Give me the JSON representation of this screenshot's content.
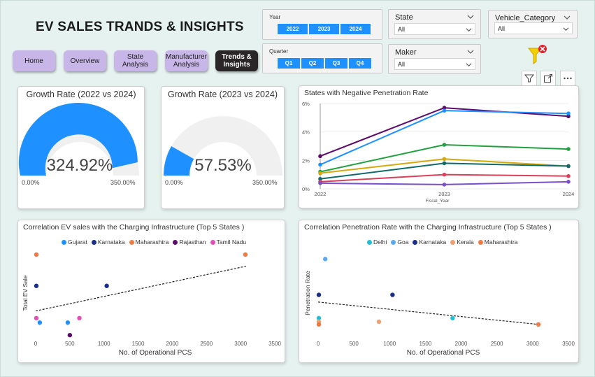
{
  "title": "EV SALES TRANDS & INSIGHTS",
  "nav": [
    {
      "label": "Home",
      "active": false
    },
    {
      "label": "Overview",
      "active": false
    },
    {
      "label": "State Analysis",
      "active": false
    },
    {
      "label": "Manufacturer Analysis",
      "active": false
    },
    {
      "label": "Trends & Insights",
      "active": true
    }
  ],
  "filters": {
    "year": {
      "label": "Year",
      "options": [
        "2022",
        "2023",
        "2024"
      ]
    },
    "quarter": {
      "label": "Quarter",
      "options": [
        "Q1",
        "Q2",
        "Q3",
        "Q4"
      ]
    },
    "state": {
      "label": "State",
      "value": "All"
    },
    "maker": {
      "label": "Maker",
      "value": "All"
    },
    "vehicle_category": {
      "label": "Vehicle_Category",
      "value": "All"
    },
    "clear_filter_icon": "filter-clear-icon"
  },
  "visual_toolbar": [
    "filter-icon",
    "focus-mode-icon",
    "more-options-icon"
  ],
  "colors": {
    "accent": "#1e90ff",
    "nav_button": "#c8b6e8",
    "nav_active": "#2a2526",
    "gauge_track": "#f0f0f0"
  },
  "gauge1": {
    "title": "Growth Rate (2022 vs 2024)",
    "value_text": "324.92%",
    "value": 324.92,
    "min_text": "0.00%",
    "max_text": "350.00%",
    "max": 350
  },
  "gauge2": {
    "title": "Growth Rate (2023 vs 2024)",
    "value_text": "57.53%",
    "value": 57.53,
    "min_text": "0.00%",
    "max_text": "350.00%",
    "max": 350
  },
  "line_chart": {
    "title": "States with Negative Penetration Rate",
    "xlabel": "Fiscal_Year"
  },
  "scatter1": {
    "title": "Correlation EV sales with the Charging Infrastructure (Top 5 States )",
    "xlabel": "No. of Operational PCS",
    "ylabel": "Total EV Sale"
  },
  "scatter2": {
    "title": "Correlation Penetration Rate with the Charging Infrastructure (Top 5 States )",
    "xlabel": "No. of Operational PCS",
    "ylabel": "Penetration Rate"
  },
  "chart_data": [
    {
      "type": "line",
      "title": "States with Negative Penetration Rate",
      "xlabel": "Fiscal_Year",
      "x": [
        "2022",
        "2023",
        "2024"
      ],
      "ylim": [
        0,
        6
      ],
      "yticks": [
        "0%",
        "2%",
        "4%",
        "6%"
      ],
      "series": [
        {
          "color": "#5c0a6b",
          "values": [
            2.3,
            5.7,
            5.1
          ]
        },
        {
          "color": "#1e90ff",
          "values": [
            1.7,
            5.5,
            5.3
          ]
        },
        {
          "color": "#22a040",
          "values": [
            1.2,
            3.1,
            2.8
          ]
        },
        {
          "color": "#d4a90b",
          "values": [
            1.1,
            2.1,
            1.6
          ]
        },
        {
          "color": "#136a6a",
          "values": [
            0.7,
            1.8,
            1.6
          ]
        },
        {
          "color": "#d9415a",
          "values": [
            0.5,
            1.0,
            0.9
          ]
        },
        {
          "color": "#7a4fc9",
          "values": [
            0.4,
            0.3,
            0.5
          ]
        }
      ]
    },
    {
      "type": "scatter",
      "title": "Correlation EV sales with the Charging Infrastructure (Top 5 States )",
      "xlabel": "No. of Operational PCS",
      "ylabel": "Total EV Sale",
      "xlim": [
        0,
        3500
      ],
      "xticks": [
        0,
        500,
        1000,
        1500,
        2000,
        2500,
        3000,
        3500
      ],
      "ylim": [
        0,
        100
      ],
      "legend": [
        "Gujarat",
        "Karnataka",
        "Maharashtra",
        "Rajasthan",
        "Tamil Nadu"
      ],
      "legend_colors": [
        "#1e90ff",
        "#1a2f8a",
        "#f07a45",
        "#5c0a6b",
        "#e34fb8"
      ],
      "points": [
        {
          "series": "Maharashtra",
          "x": 10,
          "y": 93
        },
        {
          "series": "Maharashtra",
          "x": 3070,
          "y": 93
        },
        {
          "series": "Karnataka",
          "x": 10,
          "y": 58
        },
        {
          "series": "Karnataka",
          "x": 1040,
          "y": 58
        },
        {
          "series": "Gujarat",
          "x": 60,
          "y": 17
        },
        {
          "series": "Gujarat",
          "x": 470,
          "y": 17
        },
        {
          "series": "Tamil Nadu",
          "x": 10,
          "y": 22
        },
        {
          "series": "Tamil Nadu",
          "x": 640,
          "y": 22
        },
        {
          "series": "Rajasthan",
          "x": 500,
          "y": 3
        }
      ],
      "trendline": {
        "x": [
          0,
          3080
        ],
        "y": [
          30,
          80
        ]
      }
    },
    {
      "type": "scatter",
      "title": "Correlation Penetration Rate with the Charging Infrastructure (Top 5 States )",
      "xlabel": "No. of Operational PCS",
      "ylabel": "Penetration Rate",
      "xlim": [
        0,
        3500
      ],
      "xticks": [
        0,
        500,
        1000,
        1500,
        2000,
        2500,
        3000,
        3500
      ],
      "ylim": [
        0,
        100
      ],
      "legend": [
        "Delhi",
        "Goa",
        "Karnataka",
        "Kerala",
        "Maharashtra"
      ],
      "legend_colors": [
        "#22c0d8",
        "#5aa8f0",
        "#1a2f8a",
        "#f0a070",
        "#f07a45"
      ],
      "points": [
        {
          "series": "Goa",
          "x": 100,
          "y": 88
        },
        {
          "series": "Karnataka",
          "x": 10,
          "y": 48
        },
        {
          "series": "Karnataka",
          "x": 1040,
          "y": 48
        },
        {
          "series": "Delhi",
          "x": 10,
          "y": 22
        },
        {
          "series": "Delhi",
          "x": 1880,
          "y": 22
        },
        {
          "series": "Kerala",
          "x": 10,
          "y": 18
        },
        {
          "series": "Kerala",
          "x": 850,
          "y": 18
        },
        {
          "series": "Maharashtra",
          "x": 10,
          "y": 15
        },
        {
          "series": "Maharashtra",
          "x": 3080,
          "y": 15
        }
      ],
      "trendline": {
        "x": [
          0,
          3080
        ],
        "y": [
          40,
          15
        ]
      }
    }
  ]
}
